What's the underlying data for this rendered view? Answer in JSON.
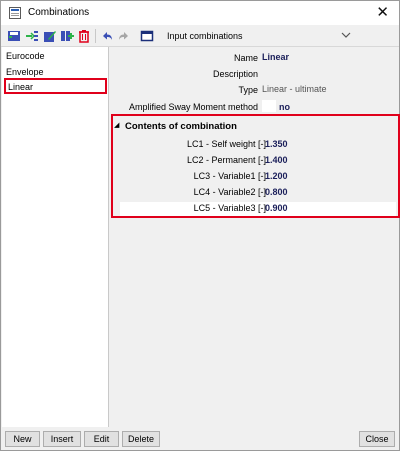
{
  "window": {
    "title": "Combinations",
    "close_label": "✕"
  },
  "toolbar": {
    "caption": "Input combinations",
    "icons": [
      "save-icon",
      "import-icon",
      "edit-icon",
      "add-icon",
      "delete-icon",
      "undo-icon",
      "redo-icon",
      "table-icon"
    ]
  },
  "sidebar": {
    "items": [
      {
        "label": "Eurocode"
      },
      {
        "label": "Envelope"
      },
      {
        "label": "Linear"
      }
    ]
  },
  "properties": {
    "name_label": "Name",
    "name_value": "Linear",
    "description_label": "Description",
    "description_value": "",
    "type_label": "Type",
    "type_value": "Linear - ultimate",
    "sway_label": "Amplified Sway Moment method",
    "sway_value": "no"
  },
  "contents": {
    "header": "Contents of combination",
    "rows": [
      {
        "label": "LC1 - Self weight [-]",
        "value": "1.350"
      },
      {
        "label": "LC2 - Permanent [-]",
        "value": "1.400"
      },
      {
        "label": "LC3 - Variable1 [-]",
        "value": "1.200"
      },
      {
        "label": "LC4 - Variable2 [-]",
        "value": "0.800"
      },
      {
        "label": "LC5 - Variable3 [-]",
        "value": "0.900"
      }
    ]
  },
  "buttons": {
    "new": "New",
    "insert": "Insert",
    "edit": "Edit",
    "delete": "Delete",
    "close": "Close"
  },
  "colors": {
    "highlight_red": "#e0001b",
    "value_blue": "#1b1f5a"
  }
}
